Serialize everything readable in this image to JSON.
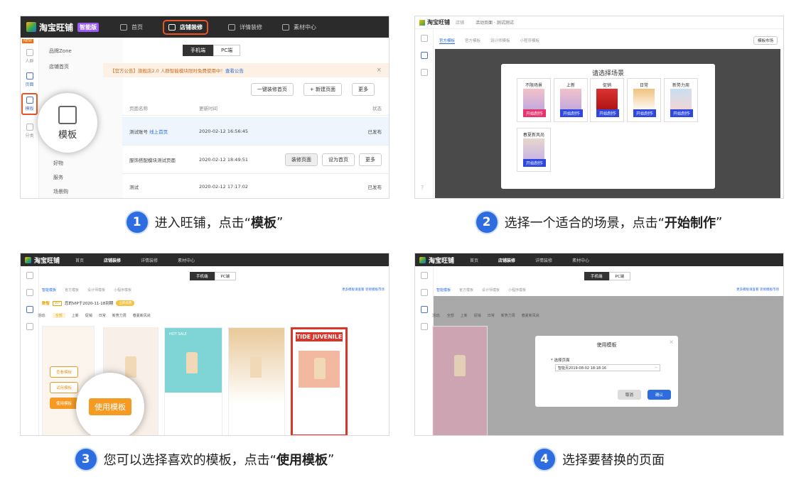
{
  "captions": [
    {
      "num": "1",
      "text": "进入旺铺，点击“",
      "bold": "模板",
      "tail": "”"
    },
    {
      "num": "2",
      "text": "选择一个适合的场景，点击“",
      "bold": "开始制作",
      "tail": "”"
    },
    {
      "num": "3",
      "text": "您可以选择喜欢的模板，点击“",
      "bold": "使用模板",
      "tail": "”"
    },
    {
      "num": "4",
      "text": "选择要替换的页面",
      "bold": "",
      "tail": ""
    }
  ],
  "app": {
    "logo": "淘宝旺铺",
    "badge": "智能版",
    "nav": [
      "首页",
      "店铺装修",
      "详情装修",
      "素材中心"
    ]
  },
  "p1": {
    "sidebar": [
      "人群",
      "页面",
      "模板",
      "分类"
    ],
    "side_new": "NEW",
    "menu": [
      "品牌Zone",
      "店铺首页",
      "好物",
      "服务",
      "场景购"
    ],
    "tabs": [
      "手机端",
      "PC端"
    ],
    "notice": "【官方公告】旗舰店2.0 人群智能模块限时免费使用中！",
    "notice_link": "查看公告",
    "btns": [
      "一键装修首页",
      "+ 新建页面",
      "更多"
    ],
    "headers": [
      "页面名称",
      "更新时间",
      "状态"
    ],
    "rows": [
      {
        "name": "测试账号",
        "tag": "线上首页",
        "time": "2020-02-12 16:56:45",
        "status": "已发布"
      },
      {
        "name": "服饰搭配模块测试页面",
        "time": "2020-02-12 18:49:51",
        "btns": [
          "装修页面",
          "设为首页",
          "更多"
        ]
      },
      {
        "name": "测试",
        "time": "2020-02-12 17:17:02",
        "status": "已发布"
      }
    ],
    "magnifier": "模板"
  },
  "p2": {
    "topbar": [
      "淘宝旺铺",
      "店铺",
      "活动页面 · 测试测试"
    ],
    "tabs": [
      "官方模板",
      "官方模板",
      "设计师模板",
      "小程序模板"
    ],
    "right_btn": "模板市场",
    "dialog_title": "请选择场景",
    "scenes": [
      "不限场景",
      "上新",
      "促销",
      "日常",
      "新势力周",
      "春夏新风尚"
    ],
    "start": "开始制作"
  },
  "p3": {
    "tabs": [
      "手机端",
      "PC端"
    ],
    "subtabs": [
      "智能模板",
      "官方模板",
      "设计师模板",
      "小程序模板"
    ],
    "vip": "数智",
    "vip_text": "VIP",
    "expire": "您的VIP于2020-11-18到期",
    "renew": "立即续费",
    "filters": [
      "活动:",
      "全部",
      "上新",
      "促销",
      "日常",
      "新势力周",
      "春夏新风尚"
    ],
    "right_link": "更多模板请查看 装修模板市场",
    "hover_btns": [
      "查看模板",
      "试用模板",
      "使用模板"
    ],
    "magnifier": "使用模板",
    "hot": "HOT SALE",
    "tide": "TIDE JUVENILE"
  },
  "p4": {
    "tabs": [
      "手机端",
      "PC端"
    ],
    "subtabs": [
      "智能模板",
      "官方模板",
      "设计师模板",
      "小程序模板"
    ],
    "filters": [
      "活动:",
      "全部",
      "上新",
      "促销",
      "日常",
      "新势力周",
      "春夏新风尚"
    ],
    "dialog_title": "使用模板",
    "field_label": "* 选择页面",
    "field_value": "智能页2019-08-02 18:18:16",
    "cancel": "取消",
    "confirm": "确认",
    "right_link": "更多模板请查看 装修模板市场"
  }
}
